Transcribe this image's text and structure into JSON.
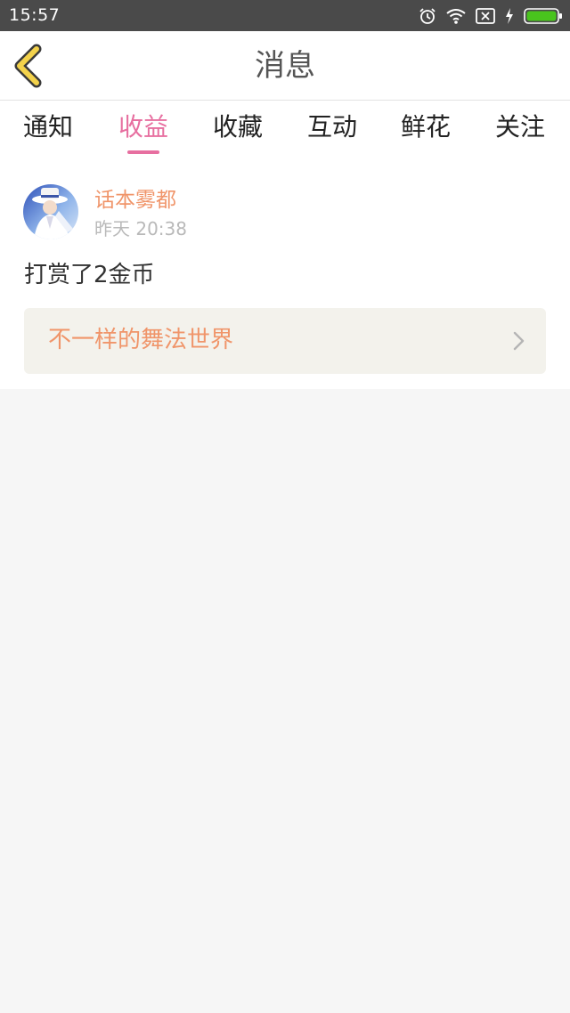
{
  "status_bar": {
    "time": "15:57",
    "icons": [
      "alarm-icon",
      "wifi-icon",
      "sim-blocked-icon",
      "charging-icon",
      "battery-icon"
    ],
    "battery_color": "#49c41d"
  },
  "navbar": {
    "title": "消息",
    "back_icon": "back-chevron-icon",
    "back_icon_color": "#f3d24b"
  },
  "tabs": [
    {
      "label": "通知",
      "active": false
    },
    {
      "label": "收益",
      "active": true
    },
    {
      "label": "收藏",
      "active": false
    },
    {
      "label": "互动",
      "active": false
    },
    {
      "label": "鲜花",
      "active": false
    },
    {
      "label": "关注",
      "active": false
    }
  ],
  "colors": {
    "accent_pink": "#e76fa0",
    "accent_orange": "#f0956a"
  },
  "message": {
    "user_name": "话本雾都",
    "timestamp": "昨天 20:38",
    "text": "打赏了2金币",
    "work_title": "不一样的舞法世界"
  }
}
